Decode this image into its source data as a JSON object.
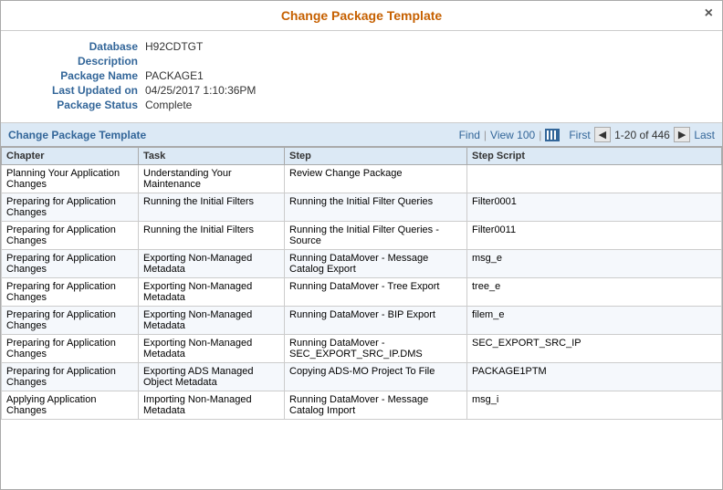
{
  "dialog": {
    "title": "Change Package Template",
    "close_label": "×"
  },
  "info": {
    "database_label": "Database",
    "database_value": "H92CDTGT",
    "description_label": "Description",
    "description_value": "",
    "package_name_label": "Package Name",
    "package_name_value": "PACKAGE1",
    "last_updated_label": "Last Updated on",
    "last_updated_value": "04/25/2017  1:10:36PM",
    "package_status_label": "Package Status",
    "package_status_value": "Complete"
  },
  "table": {
    "toolbar_title": "Change Package Template",
    "find_label": "Find",
    "view_label": "View 100",
    "first_label": "First",
    "last_label": "Last",
    "pagination": "1-20 of 446",
    "columns": [
      "Chapter",
      "Task",
      "Step",
      "Step Script"
    ],
    "rows": [
      {
        "chapter": "Planning Your Application Changes",
        "task": "Understanding Your Maintenance",
        "step": "Review Change Package",
        "script": ""
      },
      {
        "chapter": "Preparing for Application Changes",
        "task": "Running the Initial Filters",
        "step": "Running the Initial Filter Queries",
        "script": "Filter0001"
      },
      {
        "chapter": "Preparing for Application Changes",
        "task": "Running the Initial Filters",
        "step": "Running the Initial Filter Queries - Source",
        "script": "Filter0011"
      },
      {
        "chapter": "Preparing for Application Changes",
        "task": "Exporting Non-Managed Metadata",
        "step": "Running DataMover - Message Catalog Export",
        "script": "msg_e"
      },
      {
        "chapter": "Preparing for Application Changes",
        "task": "Exporting Non-Managed Metadata",
        "step": "Running DataMover - Tree Export",
        "script": "tree_e"
      },
      {
        "chapter": "Preparing for Application Changes",
        "task": "Exporting Non-Managed Metadata",
        "step": "Running DataMover - BIP Export",
        "script": "filem_e"
      },
      {
        "chapter": "Preparing for Application Changes",
        "task": "Exporting Non-Managed Metadata",
        "step": "Running DataMover - SEC_EXPORT_SRC_IP.DMS",
        "script": "SEC_EXPORT_SRC_IP"
      },
      {
        "chapter": "Preparing for Application Changes",
        "task": "Exporting ADS Managed Object Metadata",
        "step": "Copying ADS-MO Project To File",
        "script": "PACKAGE1PTM"
      },
      {
        "chapter": "Applying Application Changes",
        "task": "Importing Non-Managed Metadata",
        "step": "Running DataMover - Message Catalog Import",
        "script": "msg_i"
      }
    ]
  }
}
